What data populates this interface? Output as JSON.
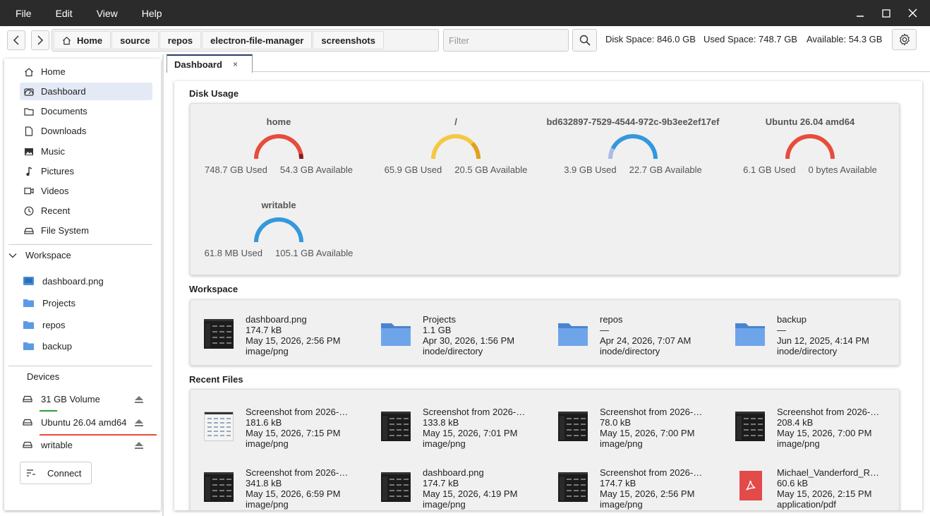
{
  "menubar": {
    "items": [
      "File",
      "Edit",
      "View",
      "Help"
    ]
  },
  "window_controls": {
    "minimize": "—",
    "maximize": "☐",
    "close": "✕"
  },
  "toolbar": {
    "breadcrumbs": [
      "Home",
      "source",
      "repos",
      "electron-file-manager",
      "screenshots"
    ],
    "filter_placeholder": "Filter",
    "disk_space": "Disk Space: 846.0 GB",
    "used_space": "Used Space: 748.7 GB",
    "available": "Available: 54.3 GB"
  },
  "sidebar": {
    "places": [
      {
        "label": "Home",
        "icon": "home-icon"
      },
      {
        "label": "Dashboard",
        "icon": "dashboard-icon",
        "active": true
      },
      {
        "label": "Documents",
        "icon": "folder-icon"
      },
      {
        "label": "Downloads",
        "icon": "file-icon"
      },
      {
        "label": "Music",
        "icon": "image-icon"
      },
      {
        "label": "Pictures",
        "icon": "music-note-icon"
      },
      {
        "label": "Videos",
        "icon": "video-icon"
      },
      {
        "label": "Recent",
        "icon": "clock-icon"
      },
      {
        "label": "File System",
        "icon": "drive-icon"
      }
    ],
    "workspace_title": "Workspace",
    "workspace_items": [
      "dashboard.png",
      "Projects",
      "repos",
      "backup"
    ],
    "devices_title": "Devices",
    "devices": [
      {
        "label": "31 GB Volume",
        "usage": 0.12,
        "color": "#2e9e3a"
      },
      {
        "label": "Ubuntu 26.04 amd64",
        "usage": 1.0,
        "color": "#e74c3c"
      },
      {
        "label": "writable",
        "usage": 0.0,
        "color": "#2e9e3a"
      }
    ],
    "connect_label": "Connect"
  },
  "tab": {
    "label": "Dashboard",
    "close": "×"
  },
  "dashboard": {
    "disk_usage_title": "Disk Usage",
    "disks": [
      {
        "name": "home",
        "used": "748.7 GB Used",
        "available": "54.3 GB Available",
        "fraction": 0.93,
        "color": "#e74c3c",
        "tail_color": "#8b1a1a"
      },
      {
        "name": "/",
        "used": "65.9 GB Used",
        "available": "20.5 GB Available",
        "fraction": 0.76,
        "color": "#f5c842",
        "tail_color": "#e0a020"
      },
      {
        "name": "bd632897-7529-4544-972c-9b3ee2ef17ef",
        "used": "3.9 GB Used",
        "available": "22.7 GB Available",
        "fraction": 0.15,
        "color": "#3498db",
        "tail_color": "#aabbe8"
      },
      {
        "name": "Ubuntu 26.04 amd64",
        "used": "6.1 GB Used",
        "available": "0 bytes Available",
        "fraction": 1.0,
        "color": "#e74c3c",
        "tail_color": "#e74c3c"
      },
      {
        "name": "writable",
        "used": "61.8 MB Used",
        "available": "105.1 GB Available",
        "fraction": 0.0,
        "color": "#3498db",
        "tail_color": "#3498db"
      }
    ],
    "workspace_title": "Workspace",
    "workspace": [
      {
        "name": "dashboard.png",
        "size": "174.7 kB",
        "date": "May 15, 2026, 2:56 PM",
        "type": "image/png",
        "kind": "image"
      },
      {
        "name": "Projects",
        "size": "1.1 GB",
        "date": "Apr 30, 2026, 1:56 PM",
        "type": "inode/directory",
        "kind": "folder"
      },
      {
        "name": "repos",
        "size": "—",
        "date": "Apr 24, 2026, 7:07 AM",
        "type": "inode/directory",
        "kind": "folder"
      },
      {
        "name": "backup",
        "size": "—",
        "date": "Jun 12, 2025, 4:14 PM",
        "type": "inode/directory",
        "kind": "folder"
      }
    ],
    "recent_title": "Recent Files",
    "recent": [
      {
        "name": "Screenshot from 2026-…",
        "size": "181.6 kB",
        "date": "May 15, 2026, 7:15 PM",
        "type": "image/png",
        "kind": "image-light"
      },
      {
        "name": "Screenshot from 2026-…",
        "size": "133.8 kB",
        "date": "May 15, 2026, 7:01 PM",
        "type": "image/png",
        "kind": "image"
      },
      {
        "name": "Screenshot from 2026-…",
        "size": "78.0 kB",
        "date": "May 15, 2026, 7:00 PM",
        "type": "image/png",
        "kind": "image"
      },
      {
        "name": "Screenshot from 2026-…",
        "size": "208.4 kB",
        "date": "May 15, 2026, 7:00 PM",
        "type": "image/png",
        "kind": "image"
      },
      {
        "name": "Screenshot from 2026-…",
        "size": "341.8 kB",
        "date": "May 15, 2026, 6:59 PM",
        "type": "image/png",
        "kind": "image"
      },
      {
        "name": "dashboard.png",
        "size": "174.7 kB",
        "date": "May 15, 2026, 4:19 PM",
        "type": "image/png",
        "kind": "image"
      },
      {
        "name": "Screenshot from 2026-…",
        "size": "174.7 kB",
        "date": "May 15, 2026, 2:56 PM",
        "type": "image/png",
        "kind": "image"
      },
      {
        "name": "Michael_Vanderford_R…",
        "size": "60.6 kB",
        "date": "May 15, 2026, 2:15 PM",
        "type": "application/pdf",
        "kind": "pdf"
      }
    ]
  }
}
